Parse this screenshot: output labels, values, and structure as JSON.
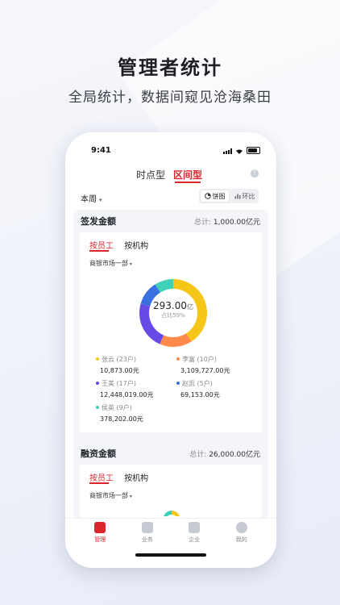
{
  "hero": {
    "title": "管理者统计",
    "subtitle": "全局统计，数据间窥见沧海桑田"
  },
  "status_bar": {
    "time": "9:41"
  },
  "top_tabs": {
    "point": "时点型",
    "range": "区间型",
    "help": "?"
  },
  "filter": {
    "period": "本周",
    "period_caret": "▾",
    "pie_label": "饼图",
    "ring_label": "环比"
  },
  "card1": {
    "title": "签发金额",
    "total_label": "总计: ",
    "total_value": "1,000.00亿元",
    "subtab_staff": "按员工",
    "subtab_org": "按机构",
    "dept": "商银市场一部",
    "dept_caret": "▾",
    "center_value": "293.00",
    "center_unit": "亿",
    "center_sub": "占比59%",
    "legend": [
      {
        "name": "张云 (23户)",
        "value": "10,873.00元",
        "color": "#f5c518"
      },
      {
        "name": "李富 (10户)",
        "value": "3,109,727.00元",
        "color": "#ff8a4c"
      },
      {
        "name": "王美 (17户)",
        "value": "12,448,019.00元",
        "color": "#6a4ae6"
      },
      {
        "name": "赵凯 (5户)",
        "value": "69,153.00元",
        "color": "#3a6fe0"
      },
      {
        "name": "侯英 (9户)",
        "value": "378,202.00元",
        "color": "#3fd1b5"
      }
    ]
  },
  "card2": {
    "title": "融资金额",
    "total_label": "总计: ",
    "total_value": "26,000.00亿元",
    "subtab_staff": "按员工",
    "subtab_org": "按机构",
    "dept": "商银市场一部",
    "dept_caret": "▾"
  },
  "nav": {
    "manage": "管理",
    "business": "业务",
    "enterprise": "企业",
    "mine": "我的"
  }
}
